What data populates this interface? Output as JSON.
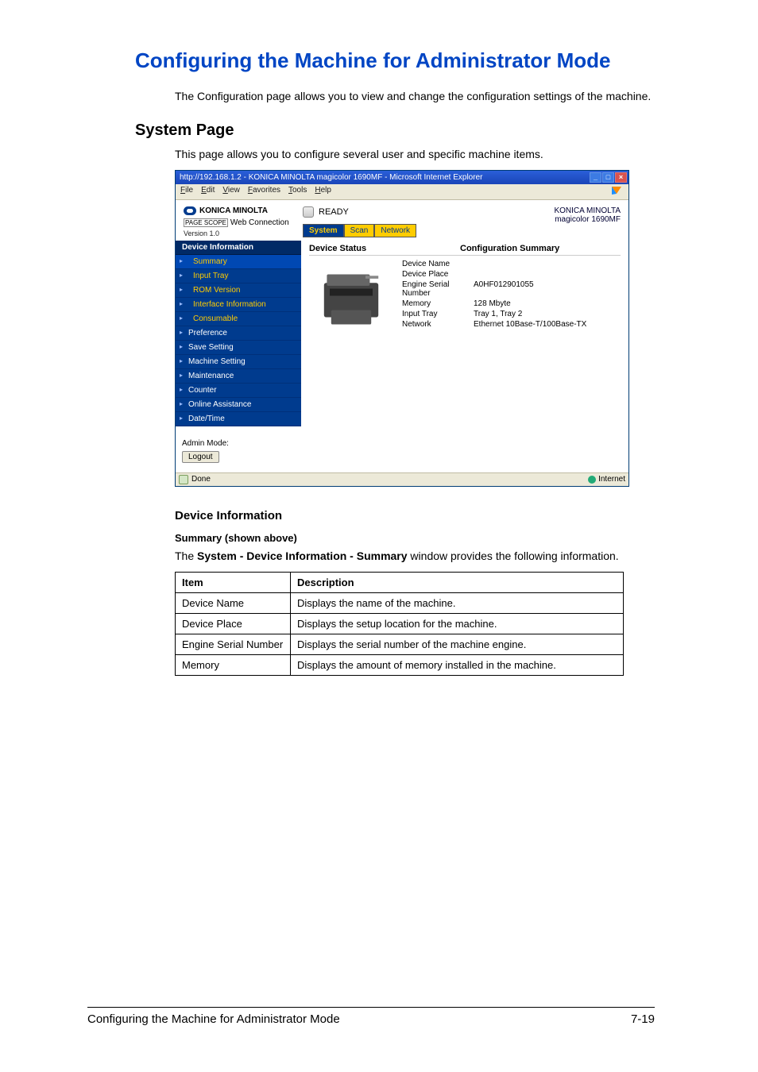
{
  "heading": "Configuring the Machine for Administrator Mode",
  "intro": "The Configuration page allows you to view and change the configuration settings of the machine.",
  "subheading": "System Page",
  "subintro": "This page allows you to configure several user and specific machine items.",
  "browser": {
    "title": "http://192.168.1.2 - KONICA MINOLTA magicolor 1690MF - Microsoft Internet Explorer",
    "menus": [
      "File",
      "Edit",
      "View",
      "Favorites",
      "Tools",
      "Help"
    ],
    "logo_text": "KONICA MINOLTA",
    "webconn_ps": "PAGE SCOPE",
    "webconn": "Web Connection",
    "version": "Version 1.0",
    "ready": "READY",
    "brand1": "KONICA MINOLTA",
    "brand2": "magicolor 1690MF",
    "tabs": [
      {
        "label": "System",
        "active": true
      },
      {
        "label": "Scan",
        "active": false
      },
      {
        "label": "Network",
        "active": false
      }
    ],
    "sidebar": {
      "header": "Device Information",
      "items": [
        {
          "label": "Summary",
          "sel": true,
          "sub": true
        },
        {
          "label": "Input Tray",
          "sel": false,
          "sub": true
        },
        {
          "label": "ROM Version",
          "sel": false,
          "sub": true
        },
        {
          "label": "Interface Information",
          "sel": false,
          "sub": true
        },
        {
          "label": "Consumable",
          "sel": false,
          "sub": true
        },
        {
          "label": "Preference",
          "sel": false,
          "sub": false
        },
        {
          "label": "Save Setting",
          "sel": false,
          "sub": false
        },
        {
          "label": "Machine Setting",
          "sel": false,
          "sub": false
        },
        {
          "label": "Maintenance",
          "sel": false,
          "sub": false
        },
        {
          "label": "Counter",
          "sel": false,
          "sub": false
        },
        {
          "label": "Online Assistance",
          "sel": false,
          "sub": false
        },
        {
          "label": "Date/Time",
          "sel": false,
          "sub": false
        }
      ],
      "admin_label": "Admin Mode:",
      "logout": "Logout"
    },
    "mainpane": {
      "status_title": "Device Status",
      "conf_title": "Configuration Summary",
      "rows": [
        {
          "k": "Device Name",
          "v": ""
        },
        {
          "k": "Device Place",
          "v": ""
        },
        {
          "k": "Engine Serial Number",
          "v": "A0HF012901055"
        },
        {
          "k": "Memory",
          "v": "128 Mbyte"
        },
        {
          "k": "Input Tray",
          "v": "Tray 1, Tray 2"
        },
        {
          "k": "Network",
          "v": "Ethernet 10Base-T/100Base-TX"
        }
      ]
    },
    "status_done": "Done",
    "status_net": "Internet"
  },
  "devinfo_heading": "Device Information",
  "summary_bold": "Summary (shown above)",
  "summary_para_pre": "The ",
  "summary_para_bold": "System - Device Information - Summary",
  "summary_para_post": " window provides the following information.",
  "table": {
    "h1": "Item",
    "h2": "Description",
    "rows": [
      {
        "item": "Device Name",
        "desc": "Displays the name of the machine."
      },
      {
        "item": "Device Place",
        "desc": "Displays the setup location for the machine."
      },
      {
        "item": "Engine Serial Number",
        "desc": "Displays the serial number of the machine engine."
      },
      {
        "item": "Memory",
        "desc": "Displays the amount of memory installed in the machine."
      }
    ]
  },
  "footer_left": "Configuring the Machine for Administrator Mode",
  "footer_right": "7-19"
}
